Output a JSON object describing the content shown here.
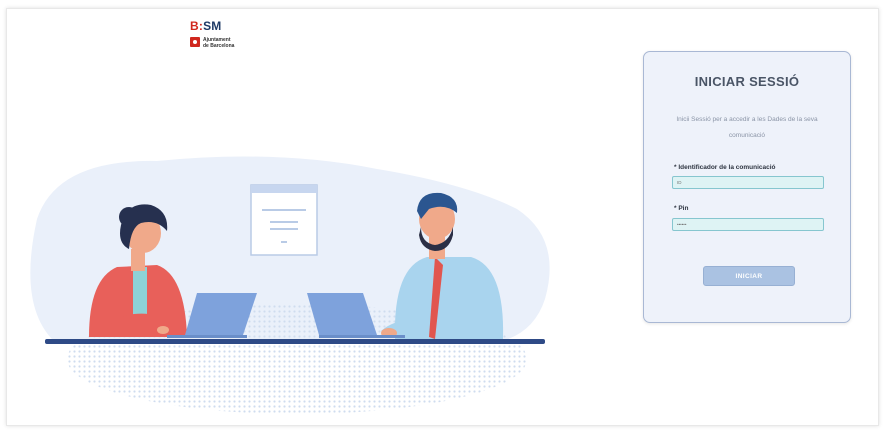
{
  "logo": {
    "brand_prefix": "B:",
    "brand_main": "SM",
    "brand_sub": "",
    "city_line1": "Ajuntament",
    "city_line2": "de Barcelona"
  },
  "login": {
    "title": "INICIAR SESSIÓ",
    "intro": "Inicii Sessió per a accedir a les Dades de la seva comunicació",
    "field1_tag": "",
    "field1_label": "* Identificador de la comunicació",
    "field1_placeholder": "ID",
    "field2_tag": "",
    "field2_label": "* Pin",
    "field2_placeholder": "••••••",
    "submit_label": "INICIAR"
  },
  "colors": {
    "accent": "#1e3a66",
    "brand_red": "#d0281e",
    "card_bg": "#eef2fa",
    "input_bg": "#def3f4",
    "button_bg": "#aac2e2"
  }
}
